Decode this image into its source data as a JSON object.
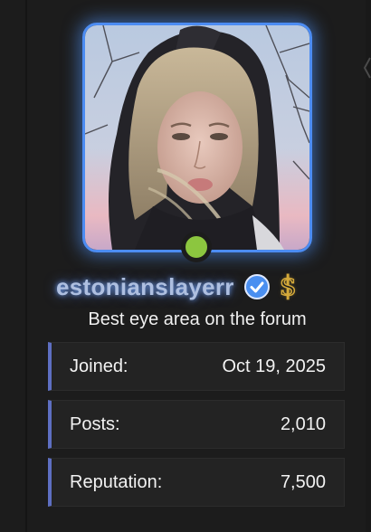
{
  "profile": {
    "username": "estonianslayerr",
    "tagline": "Best eye area on the forum",
    "online_status_color": "#8cc63f",
    "avatar_glow_color": "#4c8cf2",
    "username_color": "#aebfe0",
    "badges": [
      {
        "icon": "verified-check-icon",
        "color": "#4a8ff0"
      },
      {
        "icon": "dollar-sign-icon",
        "color": "#d4a93a"
      }
    ]
  },
  "stats": [
    {
      "label": "Joined:",
      "value": "Oct 19, 2025"
    },
    {
      "label": "Posts:",
      "value": "2,010"
    },
    {
      "label": "Reputation:",
      "value": "7,500"
    }
  ],
  "colors": {
    "background": "#1c1c1c",
    "stat_row_bg": "#232323",
    "stat_accent": "#5e6fc2",
    "text": "#f2f2f2"
  }
}
